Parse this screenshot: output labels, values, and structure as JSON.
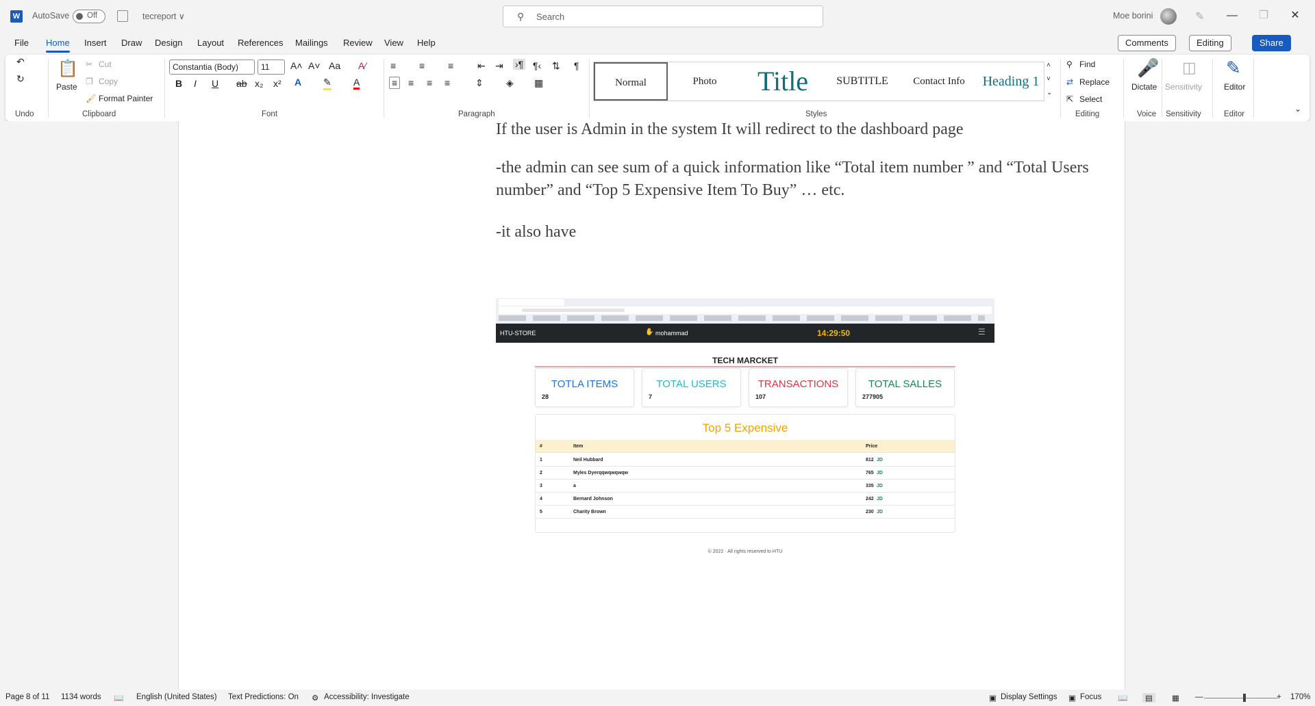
{
  "titlebar": {
    "autosave_label": "AutoSave",
    "autosave_state": "Off",
    "doc_name": "tecreport ∨",
    "search_placeholder": "Search",
    "user_name": "Moe borini"
  },
  "menu": [
    "File",
    "Home",
    "Insert",
    "Draw",
    "Design",
    "Layout",
    "References",
    "Mailings",
    "Review",
    "View",
    "Help"
  ],
  "right_buttons": {
    "comments": "Comments",
    "editing": "Editing",
    "share": "Share"
  },
  "ribbon": {
    "undo_label": "Undo",
    "clipboard": {
      "paste": "Paste",
      "cut": "Cut",
      "copy": "Copy",
      "format_painter": "Format Painter",
      "label": "Clipboard"
    },
    "font": {
      "name": "Constantia (Body)",
      "size": "11",
      "label": "Font"
    },
    "paragraph_label": "Paragraph",
    "styles": {
      "items": [
        "Normal",
        "Photo",
        "Title",
        "SUBTITLE",
        "Contact Info",
        "Heading 1"
      ],
      "label": "Styles"
    },
    "editing": {
      "find": "Find",
      "replace": "Replace",
      "select": "Select",
      "label": "Editing"
    },
    "voice": {
      "dictate": "Dictate",
      "label": "Voice"
    },
    "sensitivity": {
      "button": "Sensitivity",
      "label": "Sensitivity"
    },
    "editor": {
      "button": "Editor",
      "label": "Editor"
    }
  },
  "document": {
    "p1": "If the user is Admin in the system It will redirect to the dashboard page",
    "p2_line1": "-the admin can see sum of  a quick information like “Total item number ” and “Total Users",
    "p2_line2": "number” and “Top 5 Expensive Item To Buy”  … etc.",
    "p3": "-it also have"
  },
  "screenshot": {
    "brand": "HTU-STORE",
    "user": "mohammad",
    "clock": "14:29:50",
    "heading": "TECH MARCKET",
    "cards": [
      {
        "title": "TOTLA ITEMS",
        "value": "28",
        "color": "#1a73e8"
      },
      {
        "title": "TOTAL USERS",
        "value": "7",
        "color": "#22b8d9"
      },
      {
        "title": "TRANSACTIONS",
        "value": "107",
        "color": "#dc3545"
      },
      {
        "title": "TOTAL SALLES",
        "value": "277905",
        "color": "#198754"
      }
    ],
    "top5_title": "Top 5 Expensive",
    "table_headers": [
      "#",
      "Item",
      "Price"
    ],
    "rows": [
      {
        "n": "1",
        "item": "Neil Hubbard",
        "price": "812",
        "cur": "JD"
      },
      {
        "n": "2",
        "item": "Myles Dyerqqwqwqwqw",
        "price": "765",
        "cur": "JD"
      },
      {
        "n": "3",
        "item": "a",
        "price": "335",
        "cur": "JD"
      },
      {
        "n": "4",
        "item": "Bernard Johnson",
        "price": "242",
        "cur": "JD"
      },
      {
        "n": "5",
        "item": "Charity Brown",
        "price": "230",
        "cur": "JD"
      }
    ],
    "footer": "© 2022 · All rights reserved to HTU"
  },
  "statusbar": {
    "page": "Page 8 of 11",
    "words": "1134 words",
    "language": "English (United States)",
    "predictions": "Text Predictions: On",
    "accessibility": "Accessibility: Investigate",
    "display": "Display Settings",
    "focus": "Focus",
    "zoom": "170%"
  }
}
